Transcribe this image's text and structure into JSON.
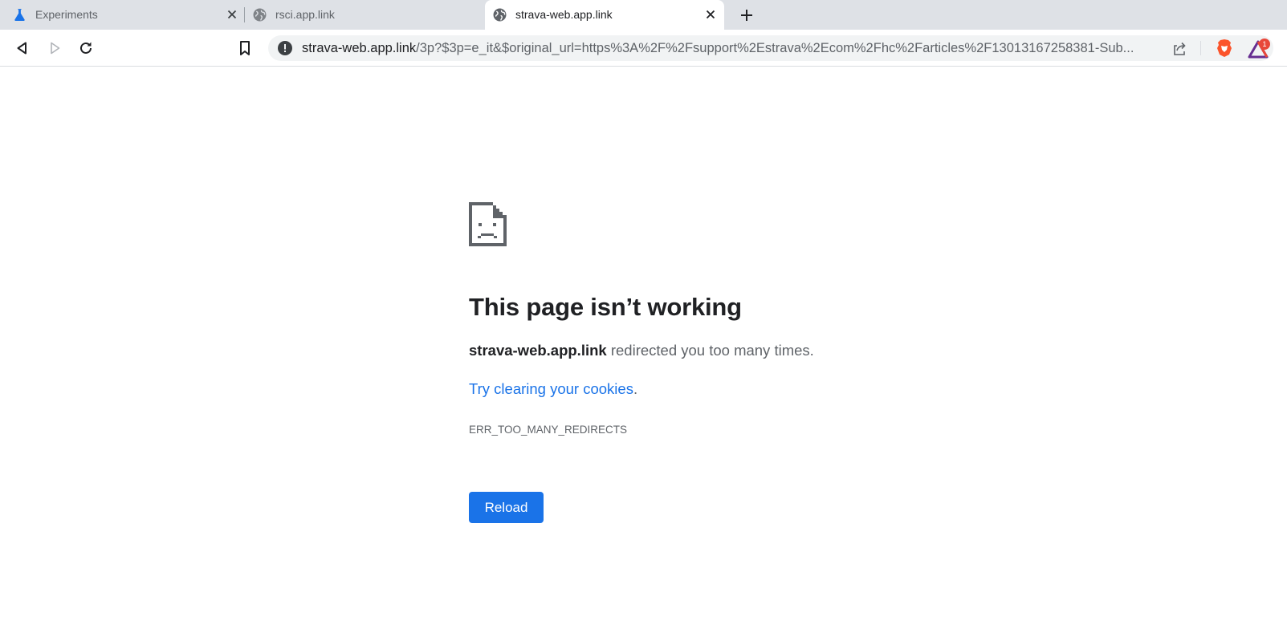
{
  "tabs": [
    {
      "title": "Experiments",
      "icon": "flask-icon",
      "active": false
    },
    {
      "title": "rsci.app.link",
      "icon": "globe-icon",
      "active": false
    },
    {
      "title": "strava-web.app.link",
      "icon": "globe-icon",
      "active": true
    }
  ],
  "address_bar": {
    "host": "strava-web.app.link",
    "path": "/3p?$3p=e_it&$original_url=https%3A%2F%2Fsupport%2Estrava%2Ecom%2Fhc%2Farticles%2F13013167258381-Sub..."
  },
  "extensions": {
    "rewards_badge": "1"
  },
  "error": {
    "heading": "This page isn’t working",
    "site": "strava-web.app.link",
    "message": " redirected you too many times.",
    "hint_link": "Try clearing your cookies",
    "hint_suffix": ".",
    "code": "ERR_TOO_MANY_REDIRECTS",
    "reload_label": "Reload"
  },
  "colors": {
    "accent": "#1a73e8",
    "tabstrip": "#dee1e6",
    "brave_orange": "#fb542b"
  }
}
